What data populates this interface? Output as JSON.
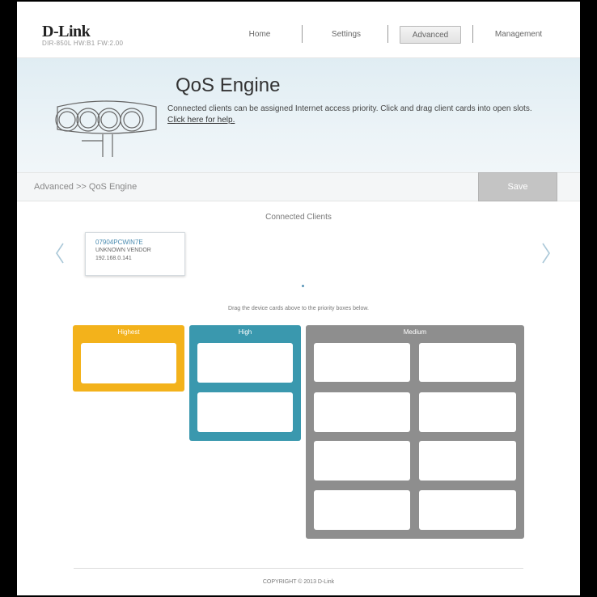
{
  "header": {
    "brand": "D-Link",
    "model_info": "DIR-850L   HW:B1   FW:2.00",
    "nav": [
      {
        "label": "Home",
        "active": false
      },
      {
        "label": "Settings",
        "active": false
      },
      {
        "label": "Advanced",
        "active": true
      },
      {
        "label": "Management",
        "active": false
      }
    ]
  },
  "banner": {
    "title": "QoS Engine",
    "description": "Connected clients can be assigned Internet access priority. Click and drag client cards into open slots.",
    "help_link": "Click here for help."
  },
  "breadcrumb": {
    "text": "Advanced >> QoS Engine",
    "save_label": "Save"
  },
  "clients": {
    "title": "Connected Clients",
    "cards": [
      {
        "name": "07904PCWIN7E",
        "vendor": "UNKNOWN VENDOR",
        "ip": "192.168.0.141"
      }
    ],
    "hint": "Drag the device cards above to the priority boxes below."
  },
  "priorities": {
    "highest": {
      "label": "Highest",
      "color": "#f3b21b",
      "slots": 1
    },
    "high": {
      "label": "High",
      "color": "#3a98ae",
      "slots": 2
    },
    "medium": {
      "label": "Medium",
      "color": "#8e8e8e",
      "slots": 8
    }
  },
  "footer": {
    "copyright": "COPYRIGHT © 2013 D-Link"
  },
  "icons": [
    "prev-arrow-icon",
    "next-arrow-icon",
    "router-illustration-icon"
  ]
}
